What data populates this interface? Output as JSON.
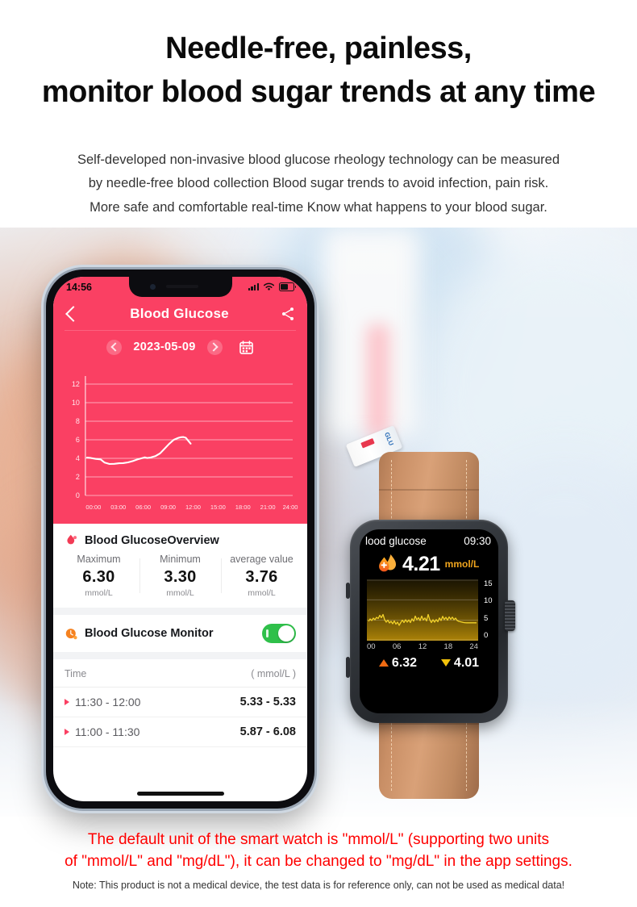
{
  "headline": {
    "line1": "Needle-free, painless,",
    "line2": "monitor blood sugar trends at any time"
  },
  "subcopy": {
    "line1": "Self-developed non-invasive blood glucose rheology technology can be measured",
    "line2": "by needle-free blood collection Blood sugar trends to avoid infection, pain risk.",
    "line3": "More safe and comfortable real-time Know what happens to your blood sugar."
  },
  "phone": {
    "status": {
      "time": "14:56"
    },
    "nav": {
      "back_icon": "chevron-left-icon",
      "title": "Blood Glucose",
      "share_icon": "share-icon"
    },
    "date_bar": {
      "prev_icon": "chevron-left-circle-icon",
      "date": "2023-05-09",
      "next_icon": "chevron-right-circle-icon",
      "calendar_icon": "calendar-icon"
    },
    "overview": {
      "icon": "blood-drop-icon",
      "title": "Blood GlucoseOverview",
      "stats": [
        {
          "label": "Maximum",
          "value": "6.30",
          "unit": "mmol/L"
        },
        {
          "label": "Minimum",
          "value": "3.30",
          "unit": "mmol/L"
        },
        {
          "label": "average value",
          "value": "3.76",
          "unit": "mmol/L"
        }
      ]
    },
    "monitor": {
      "icon": "clock-orange-icon",
      "label": "Blood Glucose Monitor",
      "toggle_state": "on"
    },
    "table": {
      "header_time": "Time",
      "header_unit": "( mmol/L )",
      "rows": [
        {
          "time": "11:30 - 12:00",
          "range": "5.33 - 5.33"
        },
        {
          "time": "11:00 - 11:30",
          "range": "5.87 - 6.08"
        }
      ]
    }
  },
  "watch": {
    "title": "lood glucose",
    "time": "09:30",
    "flame_icon": "flame-plus-icon",
    "value": "4.21",
    "unit": "mmol/L",
    "high": {
      "icon": "triangle-up-icon",
      "value": "6.32"
    },
    "low": {
      "icon": "triangle-down-icon",
      "value": "4.01"
    }
  },
  "notes": {
    "red_line1": "The default unit of the smart watch is \"mmol/L\" (supporting two units",
    "red_line2": "of \"mmol/L\" and \"mg/dL\"), it can be changed to \"mg/dL\" in the app settings.",
    "fine": "Note: This product is not a medical device, the test data is for reference only, can not be used as medical data!"
  },
  "colors": {
    "accent_pink": "#FA4063",
    "toggle_green": "#2FC04A",
    "watch_amber": "#F0A51E",
    "note_red": "#FF0000"
  },
  "chart_data": [
    {
      "id": "phone-glucose-chart",
      "type": "line",
      "title": "Blood Glucose 2023-05-09",
      "xlabel": "",
      "ylabel": "mmol/L",
      "ylim": [
        0,
        13
      ],
      "yticks": [
        0,
        2,
        4,
        6,
        8,
        10,
        12
      ],
      "xticks": [
        "00:00",
        "03:00",
        "06:00",
        "09:00",
        "12:00",
        "15:00",
        "18:00",
        "21:00",
        "24:00"
      ],
      "grid": true,
      "line_color": "#FFFFFF",
      "background": "#FA4063",
      "x": [
        0,
        0.5,
        1,
        1.5,
        2,
        2.5,
        3,
        3.5,
        4,
        4.5,
        5,
        5.5,
        6,
        6.3,
        6.6,
        7,
        7.5,
        8,
        8.5,
        9,
        9.5,
        10,
        10.3,
        10.6,
        10.9,
        11.2,
        11.5
      ],
      "values": [
        4.1,
        4.05,
        3.95,
        3.9,
        3.55,
        3.4,
        3.42,
        3.48,
        3.5,
        3.58,
        3.72,
        3.9,
        4.05,
        4.12,
        4.05,
        4.1,
        4.25,
        4.55,
        5.0,
        5.55,
        6.0,
        6.22,
        6.28,
        6.3,
        6.22,
        5.9,
        5.6
      ]
    },
    {
      "id": "watch-glucose-chart",
      "type": "line",
      "title": "lood glucose",
      "xlabel": "",
      "ylabel": "",
      "ylim": [
        0,
        15
      ],
      "yticks": [
        0,
        5,
        10,
        15
      ],
      "xticks": [
        "00",
        "06",
        "12",
        "18",
        "24"
      ],
      "grid": true,
      "line_color": "#F2D22A",
      "fill_color": "#8A6A08",
      "background": "#000000",
      "current_value": 4.21,
      "high": 6.32,
      "low": 4.01,
      "values": [
        4.6,
        5.1,
        4.8,
        5.4,
        5.0,
        5.6,
        5.3,
        6.0,
        5.5,
        6.2,
        5.0,
        4.4,
        4.8,
        4.2,
        4.6,
        4.0,
        4.5,
        3.9,
        4.3,
        3.6,
        4.2,
        4.8,
        4.3,
        5.0,
        4.4,
        4.9,
        4.3,
        5.2,
        4.6,
        5.8,
        4.9,
        5.4,
        4.7,
        6.0,
        5.2,
        5.7,
        4.8,
        6.3,
        5.0,
        4.3,
        5.0,
        4.4,
        5.2,
        4.6,
        5.5,
        4.8,
        5.9,
        5.1,
        5.6,
        5.0,
        5.8,
        5.2,
        5.7,
        5.0,
        5.4,
        4.8,
        4.6,
        4.5,
        4.4,
        4.35,
        4.3,
        4.3
      ]
    }
  ]
}
